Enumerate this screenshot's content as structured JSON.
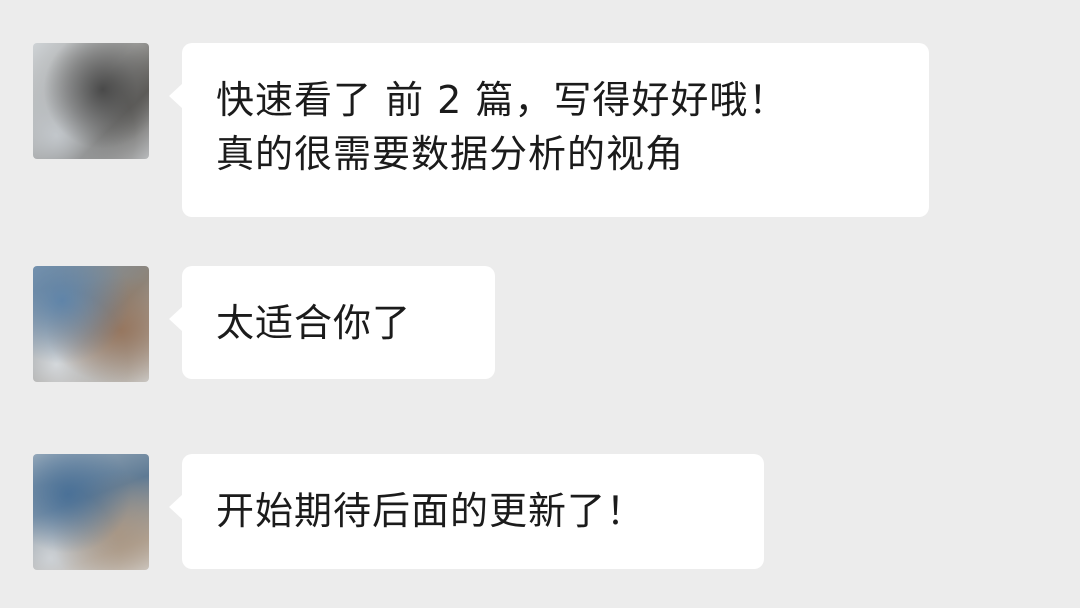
{
  "messages": [
    {
      "avatar_icon": "user-avatar-icon",
      "lines": [
        "快速看了 前 2 篇，写得好好哦！",
        "真的很需要数据分析的视角"
      ]
    },
    {
      "avatar_icon": "user-avatar-icon",
      "lines": [
        "太适合你了"
      ]
    },
    {
      "avatar_icon": "user-avatar-icon",
      "lines": [
        "开始期待后面的更新了！"
      ]
    }
  ],
  "colors": {
    "background": "#ececec",
    "bubble": "#ffffff",
    "text": "#1b1b1b"
  }
}
